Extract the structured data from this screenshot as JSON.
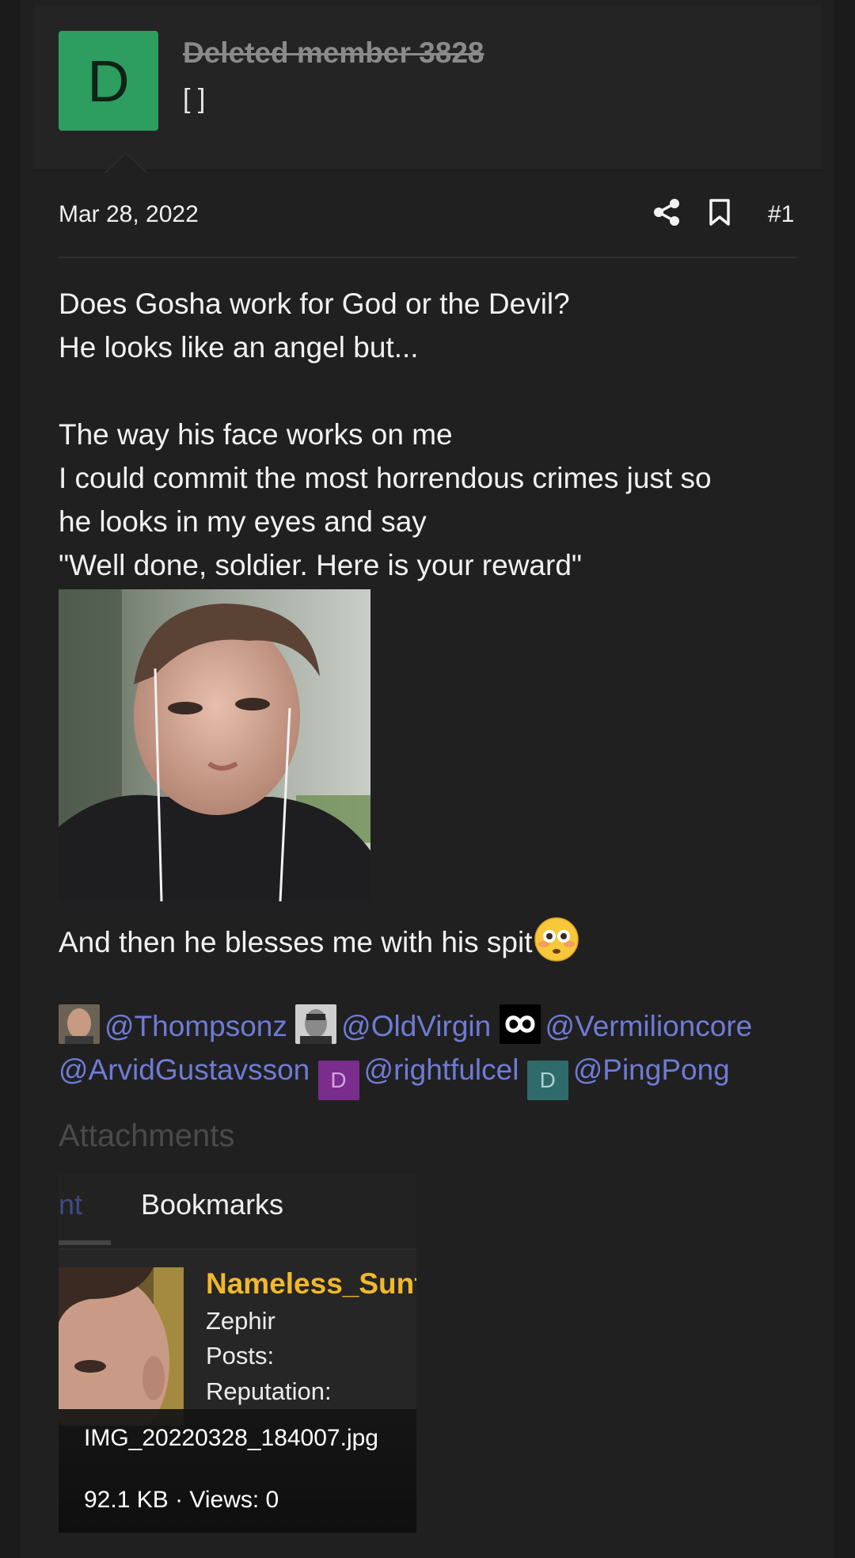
{
  "user": {
    "avatar_letter": "D",
    "avatar_color": "#2e9d60",
    "name": "Deleted member 3828",
    "title": "[ ]"
  },
  "meta": {
    "date": "Mar 28, 2022",
    "post_number": "#1",
    "share_icon": "share-icon",
    "bookmark_icon": "bookmark-icon"
  },
  "body": {
    "lines": [
      "Does Gosha work for God or the Devil?",
      "He looks like an angel but...",
      "",
      "The way his face works on me",
      "I could commit the most horrendous crimes just so",
      "he looks in my eyes and say",
      "\"Well done, soldier. Here is your reward\""
    ],
    "spit_line": "And then he blesses me with his spit",
    "emoji": "flushed-face-emoji"
  },
  "mentions": [
    {
      "name": "@Thompsonz",
      "avatar": "photo"
    },
    {
      "name": "@OldVirgin",
      "avatar": "photo"
    },
    {
      "name": "@Vermilioncore",
      "avatar": "infinity-icon"
    },
    {
      "name": "@ArvidGustavsson",
      "avatar": "none"
    },
    {
      "name": "@rightfulcel",
      "avatar_letter": "D",
      "avatar_color": "#7a2d8c"
    },
    {
      "name": "@PingPong",
      "avatar_letter": "D",
      "avatar_color": "#2f6b6b"
    }
  ],
  "mention_color": "#6f7bd6",
  "attachments": {
    "heading": "Attachments",
    "tab_partial": "nt",
    "tab_bookmarks": "Bookmarks",
    "profile_name": "Nameless_Sunf",
    "profile_rank": "Zephir",
    "profile_posts": "Posts:",
    "profile_reputation": "Reputation:",
    "file_name": "IMG_20220328_184007.jpg",
    "file_meta": "92.1 KB · Views: 0"
  }
}
